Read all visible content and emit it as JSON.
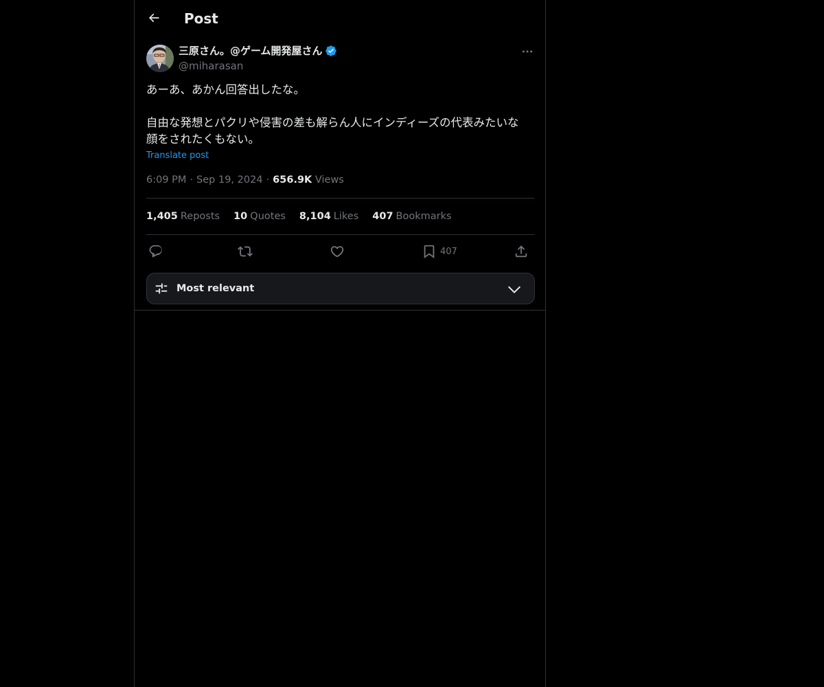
{
  "header": {
    "title": "Post"
  },
  "author": {
    "display_name": "三原さん。@ゲーム開発屋さん",
    "handle": "@miharasan",
    "verified": true
  },
  "post": {
    "lines": [
      "あーあ、あかん回答出したな。",
      "",
      "自由な発想とパクリや侵害の差も解らん人にインディーズの代表みたいな",
      "顔をされたくもない。"
    ],
    "translate_label": "Translate post",
    "time": "6:09 PM",
    "date": "Sep 19, 2024",
    "views_count": "656.9K",
    "views_label": "Views",
    "separator": "·"
  },
  "stats": [
    {
      "num": "1,405",
      "label": "Reposts"
    },
    {
      "num": "10",
      "label": "Quotes"
    },
    {
      "num": "8,104",
      "label": "Likes"
    },
    {
      "num": "407",
      "label": "Bookmarks"
    }
  ],
  "actions": {
    "bookmark_count": "407"
  },
  "sort": {
    "label": "Most relevant"
  },
  "colors": {
    "background": "#000000",
    "text": "#e7e9ea",
    "muted": "#71767b",
    "accent": "#1d9bf0",
    "border": "#2f3336"
  },
  "icons": {
    "back": "arrow-left-icon",
    "verified": "verified-badge-icon",
    "more": "more-horizontal-icon",
    "reply": "reply-icon",
    "repost": "repost-icon",
    "like": "heart-icon",
    "bookmark": "bookmark-icon",
    "share": "share-icon",
    "sort": "sliders-icon",
    "chevron": "chevron-down-icon"
  }
}
